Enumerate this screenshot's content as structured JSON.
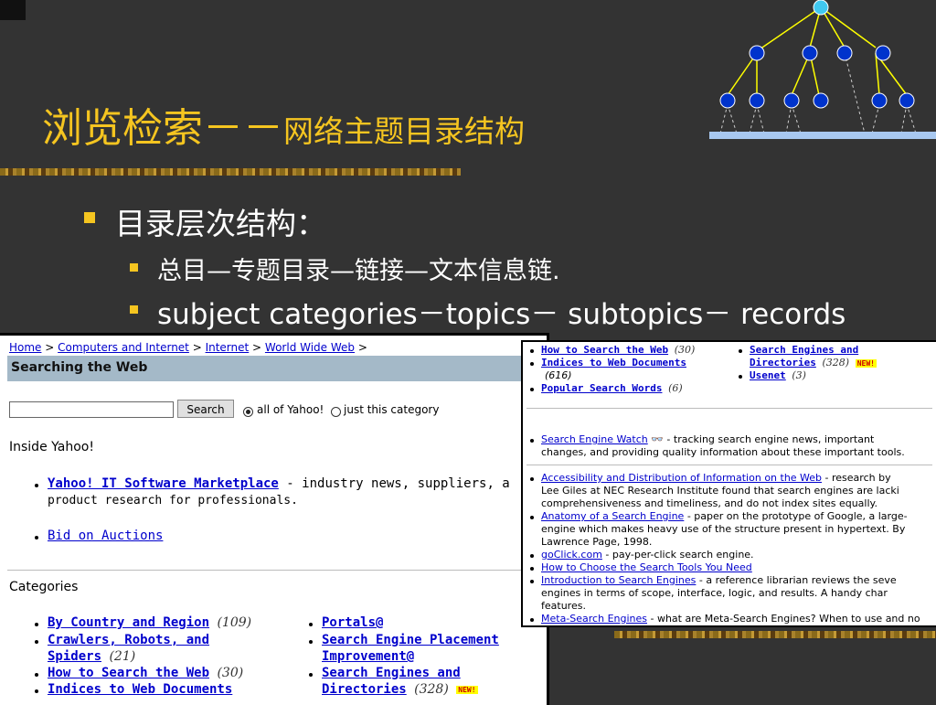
{
  "slide": {
    "title_main": "浏览检索－－",
    "title_sub": "网络主题目录结构",
    "bullet1": "目录层次结构：",
    "bullet2": "总目—专题目录—链接—文本信息链.",
    "bullet3": "subject categories－topics－ subtopics－ records"
  },
  "yahoo": {
    "breadcrumb": [
      {
        "label": "Home"
      },
      {
        "label": "Computers and Internet"
      },
      {
        "label": "Internet"
      },
      {
        "label": "World Wide Web"
      }
    ],
    "page_title": "Searching the Web",
    "search_button": "Search",
    "radio_all": "all of Yahoo!",
    "radio_cat": "just this category",
    "inside_heading": "Inside Yahoo!",
    "inside_items": [
      {
        "link": "Yahoo! IT Software Marketplace",
        "desc": " - industry news, suppliers, a",
        "desc2": "product research for professionals."
      },
      {
        "link": "Bid on Auctions"
      }
    ],
    "categories_heading": "Categories",
    "cat_col1": [
      {
        "l1": "By Country and Region",
        "count": "(109)"
      },
      {
        "l1": "Crawlers, Robots, and",
        "l2": "Spiders",
        "count": "(21)"
      },
      {
        "l1": "How to Search the Web",
        "count": "(30)"
      },
      {
        "l1": "Indices to Web Documents"
      }
    ],
    "cat_col2": [
      {
        "l1": "Portals@"
      },
      {
        "l1": "Search Engine Placement",
        "l2": "Improvement@"
      },
      {
        "l1": "Search Engines and",
        "l2": "Directories",
        "count": "(328)",
        "badge": "NEW!"
      }
    ]
  },
  "panel2": {
    "top_col1": [
      {
        "link": "How to Search the Web",
        "count": "(30)"
      },
      {
        "link": "Indices to Web Documents",
        "count2": "(616)"
      },
      {
        "link": "Popular Search Words",
        "count": "(6)"
      }
    ],
    "top_col2": [
      {
        "link": "Search Engines and",
        "link2": "Directories",
        "count": "(328)",
        "badge": "NEW!"
      },
      {
        "link": "Usenet",
        "count": "(3)"
      }
    ],
    "site1": {
      "link": "Search Engine Watch",
      "desc": " - tracking search engine news, important",
      "desc2": "changes, and providing quality information about these important tools."
    },
    "sites": [
      {
        "link": "Accessibility and Distribution of Information on the Web",
        "desc": " - research by",
        "lines": [
          "Lee Giles at NEC Research Institute found that search engines are lacki",
          "comprehensiveness and timeliness, and do not index sites equally."
        ]
      },
      {
        "link": "Anatomy of a Search Engine",
        "desc": " - paper on the prototype of Google, a large-",
        "lines": [
          "engine which makes heavy use of the structure present in hypertext. By",
          "Lawrence Page, 1998."
        ]
      },
      {
        "link": "goClick.com",
        "desc": " - pay-per-click search engine.",
        "lines": []
      },
      {
        "link": "How to Choose the Search Tools You Need",
        "desc": "",
        "lines": []
      },
      {
        "link": "Introduction to Search Engines",
        "desc": " - a reference librarian reviews the seve",
        "lines": [
          "engines in terms of scope, interface, logic, and results. A handy char",
          "features."
        ]
      },
      {
        "link": "Meta-Search Engines",
        "desc": " - what are Meta-Search Engines? When to use and no",
        "lines": []
      }
    ]
  }
}
